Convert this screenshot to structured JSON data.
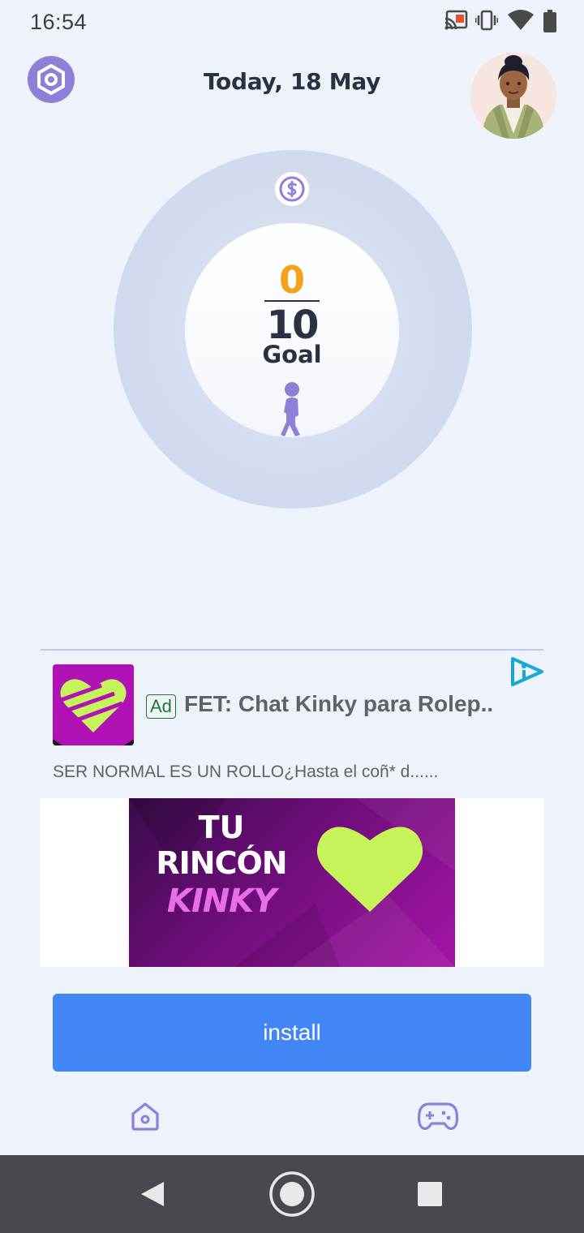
{
  "status_bar": {
    "time": "16:54",
    "icons": [
      "cast-icon",
      "vibrate-icon",
      "wifi-icon",
      "battery-icon"
    ]
  },
  "header": {
    "date_title": "Today, 18 May",
    "settings_icon": "hexagon-settings-icon",
    "avatar": "user-avatar"
  },
  "progress": {
    "current": "0",
    "goal": "10",
    "goal_label": "Goal",
    "coin_icon": "dollar-coin-icon",
    "activity_icon": "walking-person-icon"
  },
  "ad": {
    "badge": "Ad",
    "title": "FET: Chat Kinky para Rolep..",
    "description": "SER NORMAL ES UN ROLLO¿Hasta el coñ* d......",
    "banner_line1": "TU",
    "banner_line2": "RINCÓN",
    "banner_line3": "KINKY",
    "cta": "install"
  },
  "bottom_tabs": [
    "home-icon",
    "gamepad-icon"
  ],
  "nav_bar": [
    "back-icon",
    "home-circle-icon",
    "recents-icon"
  ],
  "colors": {
    "background": "#eef3fb",
    "accent_purple": "#8e80d6",
    "current_steps": "#f4a21b",
    "install_button": "#4285f4",
    "heart_lime": "#c6f25a",
    "ad_purple": "#b012b6"
  }
}
